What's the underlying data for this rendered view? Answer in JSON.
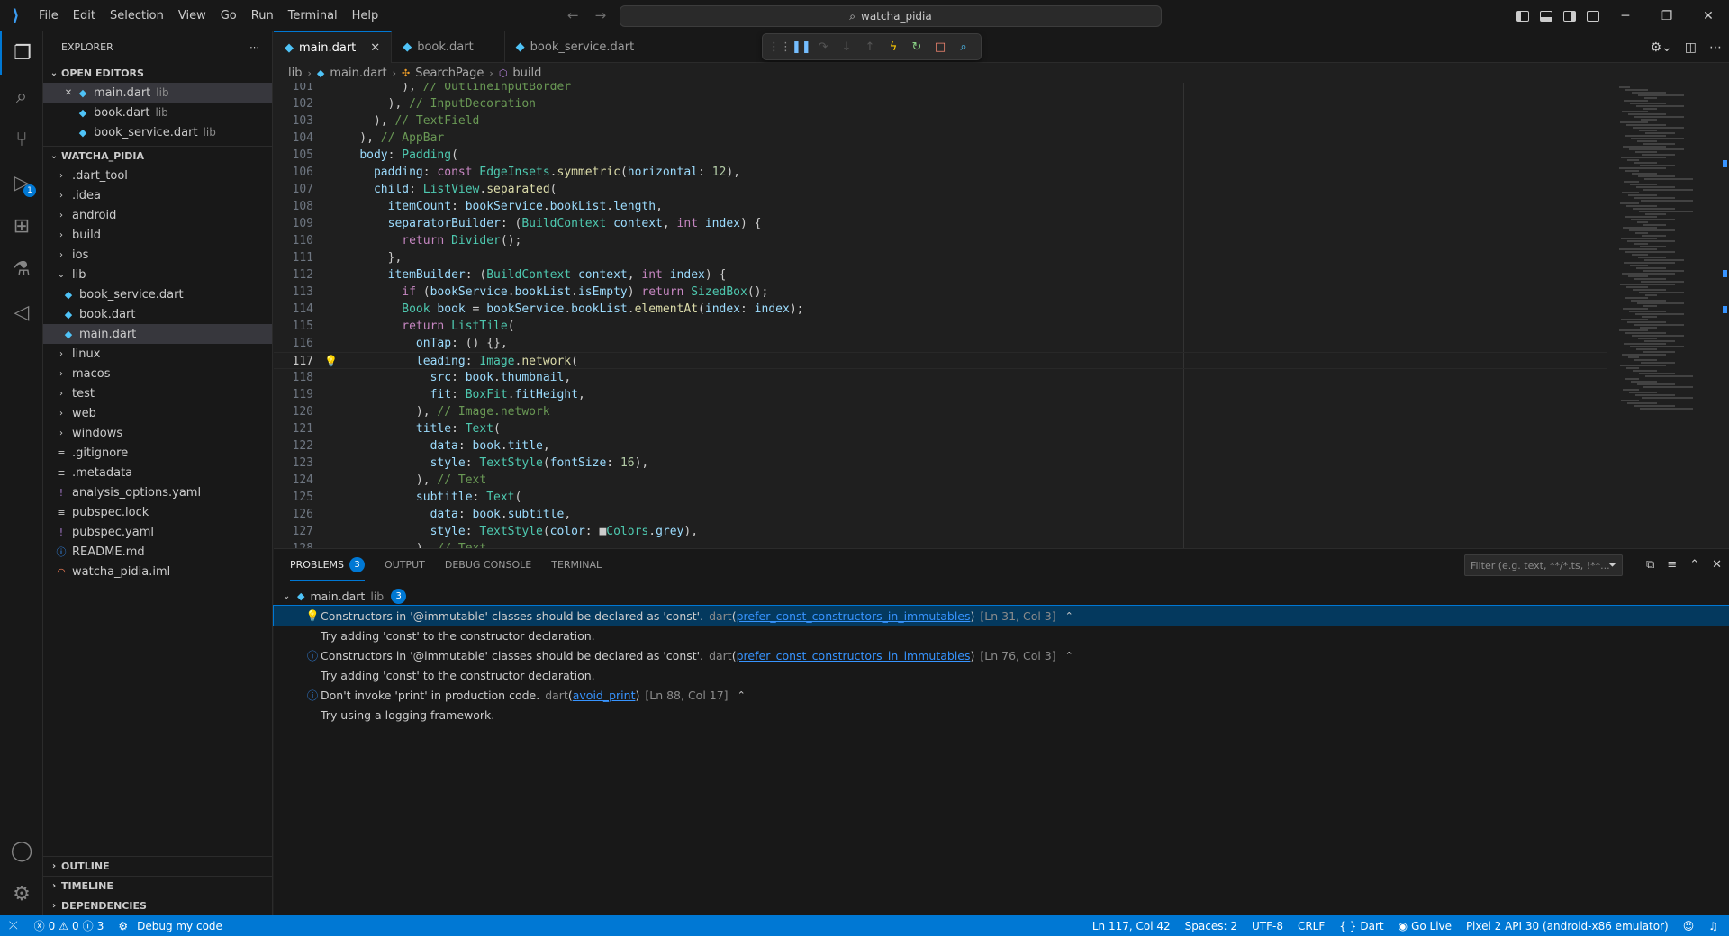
{
  "titlebar": {
    "menu": [
      "File",
      "Edit",
      "Selection",
      "View",
      "Go",
      "Run",
      "Terminal",
      "Help"
    ],
    "search_text": "watcha_pidia"
  },
  "activity": {
    "debug_badge": "1"
  },
  "sidebar": {
    "title": "EXPLORER",
    "open_editors_title": "OPEN EDITORS",
    "open_editors": [
      {
        "name": "main.dart",
        "desc": "lib"
      },
      {
        "name": "book.dart",
        "desc": "lib"
      },
      {
        "name": "book_service.dart",
        "desc": "lib"
      }
    ],
    "project_title": "WATCHA_PIDIA",
    "tree": [
      {
        "name": ".dart_tool",
        "type": "folder"
      },
      {
        "name": ".idea",
        "type": "folder"
      },
      {
        "name": "android",
        "type": "folder"
      },
      {
        "name": "build",
        "type": "folder"
      },
      {
        "name": "ios",
        "type": "folder"
      },
      {
        "name": "lib",
        "type": "folder-open"
      },
      {
        "name": "book_service.dart",
        "type": "dart"
      },
      {
        "name": "book.dart",
        "type": "dart"
      },
      {
        "name": "main.dart",
        "type": "dart"
      },
      {
        "name": "linux",
        "type": "folder"
      },
      {
        "name": "macos",
        "type": "folder"
      },
      {
        "name": "test",
        "type": "folder"
      },
      {
        "name": "web",
        "type": "folder"
      },
      {
        "name": "windows",
        "type": "folder"
      },
      {
        "name": ".gitignore",
        "type": "file"
      },
      {
        "name": ".metadata",
        "type": "file"
      },
      {
        "name": "analysis_options.yaml",
        "type": "yaml"
      },
      {
        "name": "pubspec.lock",
        "type": "file"
      },
      {
        "name": "pubspec.yaml",
        "type": "yaml"
      },
      {
        "name": "README.md",
        "type": "info"
      },
      {
        "name": "watcha_pidia.iml",
        "type": "rss"
      }
    ],
    "bottom_sections": [
      "OUTLINE",
      "TIMELINE",
      "DEPENDENCIES"
    ]
  },
  "tabs": [
    {
      "label": "main.dart",
      "active": true
    },
    {
      "label": "book.dart",
      "active": false
    },
    {
      "label": "book_service.dart",
      "active": false
    }
  ],
  "breadcrumbs": [
    "lib",
    "main.dart",
    "SearchPage",
    "build"
  ],
  "editor": {
    "current_line": 117,
    "lines": [
      {
        "n": "101",
        "t": "          ), // OutlineInputBorder"
      },
      {
        "n": "102",
        "t": "        ), // InputDecoration"
      },
      {
        "n": "103",
        "t": "      ), // TextField"
      },
      {
        "n": "104",
        "t": "    ), // AppBar"
      },
      {
        "n": "105",
        "t": "    body: Padding("
      },
      {
        "n": "106",
        "t": "      padding: const EdgeInsets.symmetric(horizontal: 12),"
      },
      {
        "n": "107",
        "t": "      child: ListView.separated("
      },
      {
        "n": "108",
        "t": "        itemCount: bookService.bookList.length,"
      },
      {
        "n": "109",
        "t": "        separatorBuilder: (BuildContext context, int index) {"
      },
      {
        "n": "110",
        "t": "          return Divider();"
      },
      {
        "n": "111",
        "t": "        },"
      },
      {
        "n": "112",
        "t": "        itemBuilder: (BuildContext context, int index) {"
      },
      {
        "n": "113",
        "t": "          if (bookService.bookList.isEmpty) return SizedBox();"
      },
      {
        "n": "114",
        "t": "          Book book = bookService.bookList.elementAt(index: index);"
      },
      {
        "n": "115",
        "t": "          return ListTile("
      },
      {
        "n": "116",
        "t": "            onTap: () {},"
      },
      {
        "n": "117",
        "t": "            leading: Image.network("
      },
      {
        "n": "118",
        "t": "              src: book.thumbnail,"
      },
      {
        "n": "119",
        "t": "              fit: BoxFit.fitHeight,"
      },
      {
        "n": "120",
        "t": "            ), // Image.network"
      },
      {
        "n": "121",
        "t": "            title: Text("
      },
      {
        "n": "122",
        "t": "              data: book.title,"
      },
      {
        "n": "123",
        "t": "              style: TextStyle(fontSize: 16),"
      },
      {
        "n": "124",
        "t": "            ), // Text"
      },
      {
        "n": "125",
        "t": "            subtitle: Text("
      },
      {
        "n": "126",
        "t": "              data: book.subtitle,"
      },
      {
        "n": "127",
        "t": "              style: TextStyle(color: ■Colors.grey),"
      },
      {
        "n": "128",
        "t": "            ), // Text"
      }
    ]
  },
  "panel": {
    "tabs": [
      "PROBLEMS",
      "OUTPUT",
      "DEBUG CONSOLE",
      "TERMINAL"
    ],
    "problems_count": "3",
    "filter_placeholder": "Filter (e.g. text, **/*.ts, !**...",
    "file_group": {
      "name": "main.dart",
      "desc": "lib",
      "count": "3"
    },
    "problems": [
      {
        "message": "Constructors in '@immutable' classes should be declared as 'const'.",
        "source": "dart",
        "code": "prefer_const_constructors_in_immutables",
        "position": "[Ln 31, Col 3]",
        "hint": "Try adding 'const' to the constructor declaration."
      },
      {
        "message": "Constructors in '@immutable' classes should be declared as 'const'.",
        "source": "dart",
        "code": "prefer_const_constructors_in_immutables",
        "position": "[Ln 76, Col 3]",
        "hint": "Try adding 'const' to the constructor declaration."
      },
      {
        "message": "Don't invoke 'print' in production code.",
        "source": "dart",
        "code": "avoid_print",
        "position": "[Ln 88, Col 17]",
        "hint": "Try using a logging framework."
      }
    ]
  },
  "statusbar": {
    "errors": "0",
    "warnings": "0",
    "infos": "3",
    "debug": "Debug my code",
    "position": "Ln 117, Col 42",
    "spaces": "Spaces: 2",
    "encoding": "UTF-8",
    "eol": "CRLF",
    "language": "Dart",
    "golive": "Go Live",
    "device": "Pixel 2 API 30 (android-x86 emulator)"
  },
  "colors": {
    "accent": "#0078d4",
    "dart": "#4fc3f7",
    "keyword": "#c586c0",
    "type": "#4ec9b0",
    "string": "#ce9178",
    "func": "#dcdcaa",
    "param": "#9cdcfe",
    "number": "#b5cea8",
    "comment": "#6a9955"
  }
}
